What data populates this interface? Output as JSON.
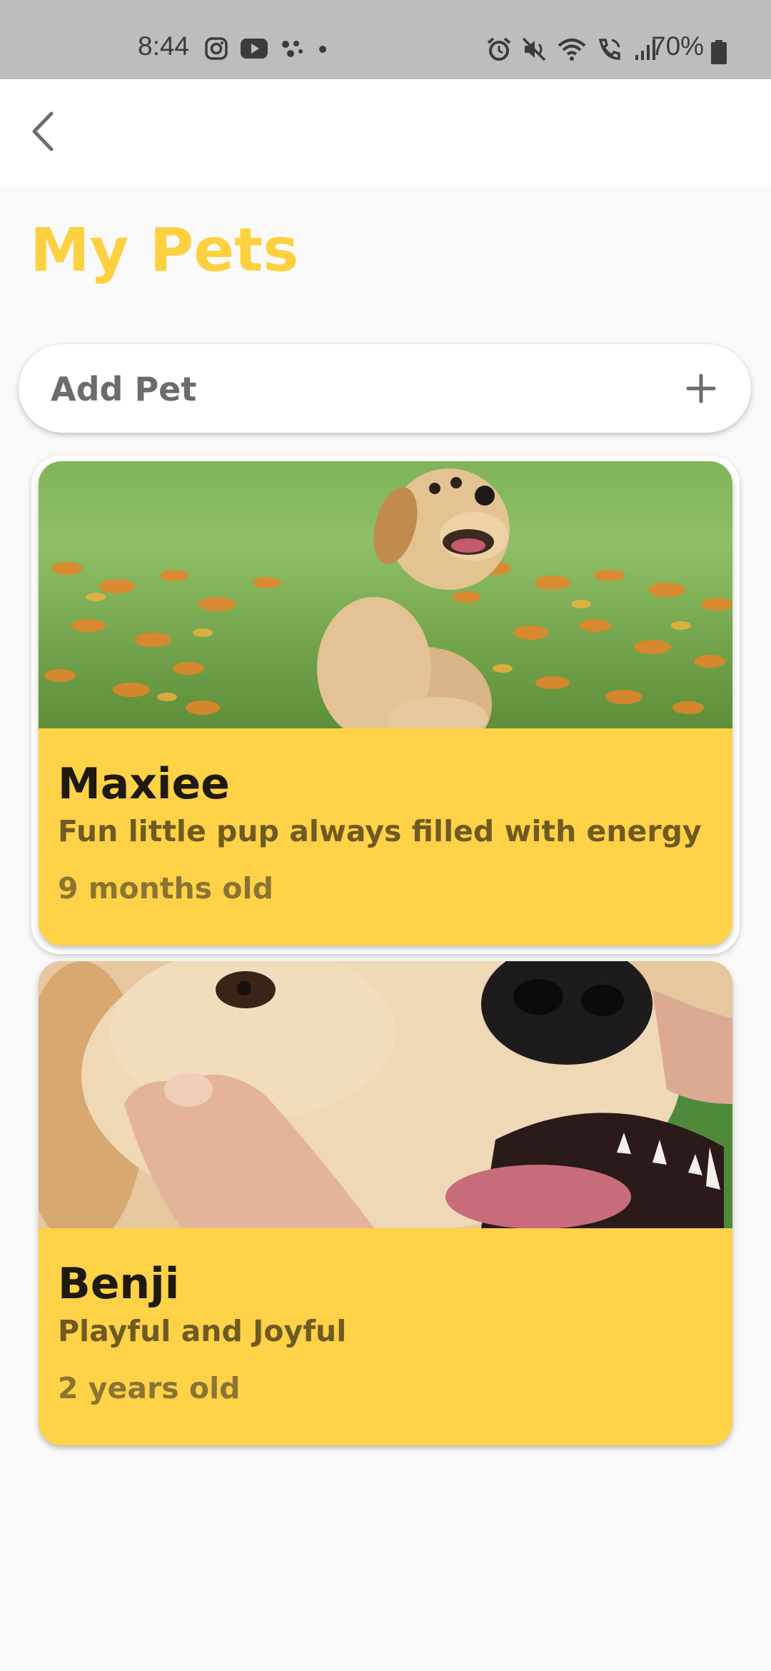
{
  "status_bar": {
    "time": "8:44",
    "battery": "70%",
    "left_icons": [
      "instagram-icon",
      "youtube-icon",
      "assistant-icon",
      "dot-icon"
    ],
    "right_icons": [
      "alarm-icon",
      "mute-icon",
      "wifi-icon",
      "call-icon",
      "signal-icon",
      "battery-icon"
    ]
  },
  "app_bar": {
    "back_icon": "chevron-left-icon"
  },
  "page": {
    "title": "My Pets"
  },
  "add_pet": {
    "label": "Add Pet",
    "icon": "plus-icon"
  },
  "pets": [
    {
      "name": "Maxiee",
      "description": "Fun little pup always filled with energy",
      "age": "9 months old"
    },
    {
      "name": "Benji",
      "description": "Playful and Joyful",
      "age": "2 years old"
    }
  ],
  "colors": {
    "accent": "#fdd03f",
    "card": "#ffd247",
    "status_bar": "#bdbdbd"
  }
}
